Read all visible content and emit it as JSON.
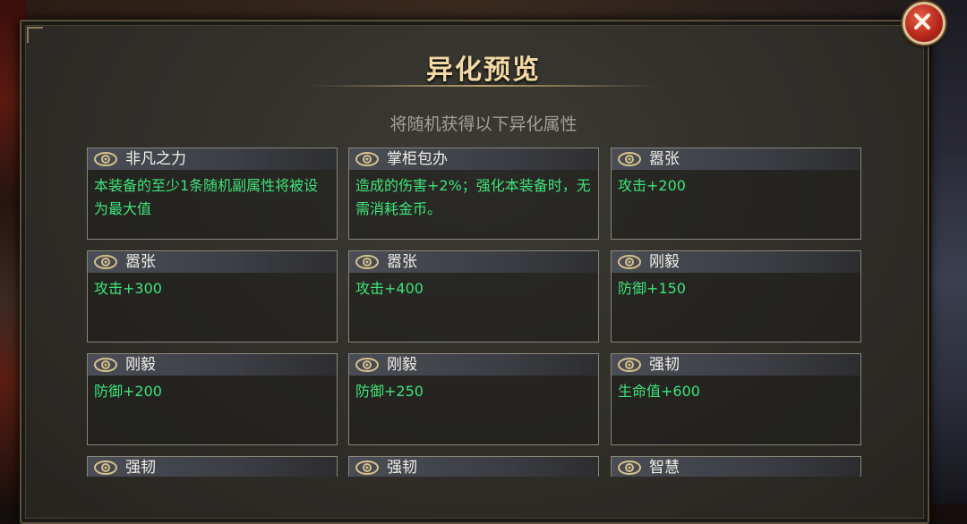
{
  "dialog": {
    "title": "异化预览",
    "subtitle": "将随机获得以下异化属性",
    "close_icon": "close-x-icon"
  },
  "colors": {
    "title": "#f3d9a4",
    "subtitle": "#a39f98",
    "effect_text": "#3fe37a",
    "card_border": "#8a8578",
    "close_button": "#b8281c"
  },
  "cards": [
    {
      "name": "非凡之力",
      "desc": "本装备的至少1条随机副属性将被设为最大值",
      "icon": "eye-icon"
    },
    {
      "name": "掌柜包办",
      "desc": "造成的伤害+2%；强化本装备时，无需消耗金币。",
      "icon": "eye-icon"
    },
    {
      "name": "嚣张",
      "desc": "攻击+200",
      "icon": "eye-icon"
    },
    {
      "name": "嚣张",
      "desc": "攻击+300",
      "icon": "eye-icon"
    },
    {
      "name": "嚣张",
      "desc": "攻击+400",
      "icon": "eye-icon"
    },
    {
      "name": "刚毅",
      "desc": "防御+150",
      "icon": "eye-icon"
    },
    {
      "name": "刚毅",
      "desc": "防御+200",
      "icon": "eye-icon"
    },
    {
      "name": "刚毅",
      "desc": "防御+250",
      "icon": "eye-icon"
    },
    {
      "name": "强韧",
      "desc": "生命值+600",
      "icon": "eye-icon"
    },
    {
      "name": "强韧",
      "desc": "",
      "icon": "eye-icon"
    },
    {
      "name": "强韧",
      "desc": "",
      "icon": "eye-icon"
    },
    {
      "name": "智慧",
      "desc": "",
      "icon": "eye-icon"
    }
  ]
}
